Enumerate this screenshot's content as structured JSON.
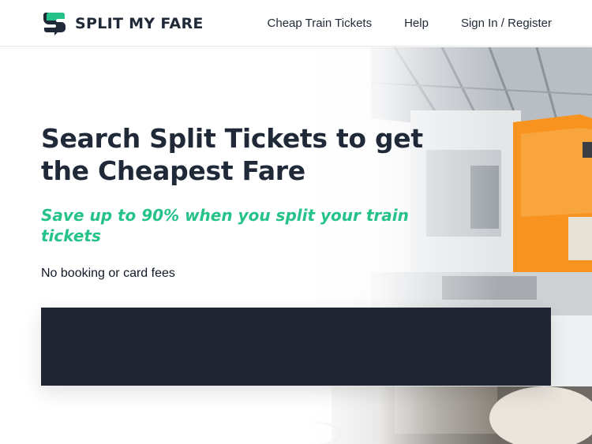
{
  "header": {
    "logo": {
      "text": "SPLIT MY FARE",
      "icon": "split-my-fare-logo-icon",
      "color": "#25c28a"
    },
    "nav": [
      {
        "label": "Cheap Train Tickets"
      },
      {
        "label": "Help"
      },
      {
        "label": "Sign In / Register"
      }
    ]
  },
  "hero": {
    "headline": "Search Split Tickets to get the Cheapest Fare",
    "subheadline": "Save up to 90% when you split your train tickets",
    "tagline": "No booking or card fees",
    "background": "train-station-photo",
    "search_panel_color": "#1f2533",
    "accent_color": "#25c28a"
  }
}
